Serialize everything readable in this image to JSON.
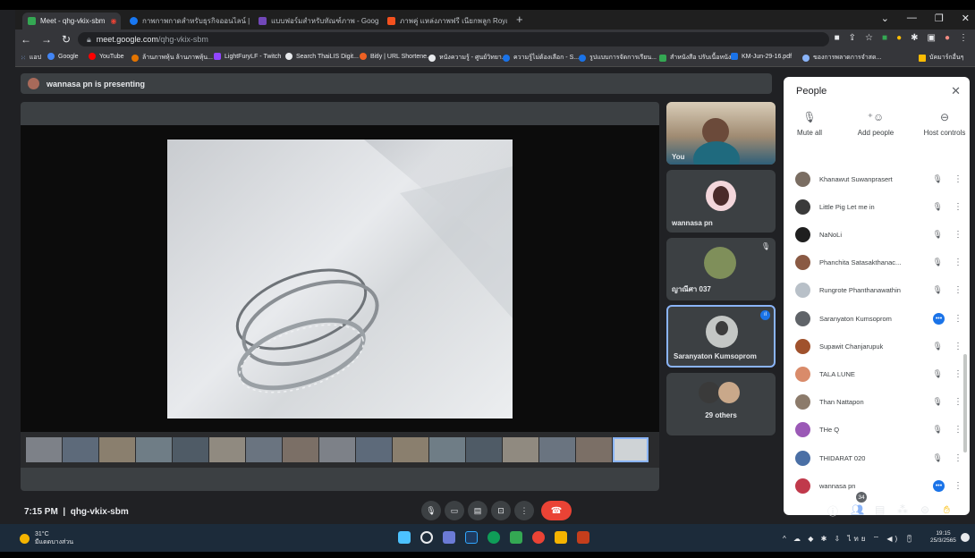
{
  "browser": {
    "tabs": [
      {
        "label": "Meet - qhg-vkix-sbm",
        "color": "#34a853"
      },
      {
        "label": "กาพกาพกาดสำหรับธุรกิจออนไลน์ | Fac",
        "color": "#1877f2"
      },
      {
        "label": "แบบฟอร์มสำหรับทัณฑ์ภาพ - Google ร",
        "color": "#7248b9"
      },
      {
        "label": "ภาพคู่ แหล่งภาพฟรี เนียกพลูก Royal",
        "color": "#f4511e"
      }
    ],
    "url_host": "meet.google.com",
    "url_path": "/qhg-vkix-sbm",
    "bookmarks": [
      "แอป",
      "Google",
      "YouTube",
      "ล้านภาพหุ้น ล้านภาพหุ้น...",
      "LightFuryLF - Twitch",
      "Search ThaiLIS Digit...",
      "Bitly | URL Shortene...",
      "หนังความรู้ - ศูนย์วิทยา...",
      "ความรู้ไม่ต้องเลือก - S...",
      "รูปแบบการจัดการเรียน...",
      "สำหนังสือ ปรับเนื้อหนัง...",
      "KM-Jun-29-16.pdf",
      "ของการพลาดการจำสด...",
      "บัคมาร์กอื่นๆ"
    ]
  },
  "meet": {
    "presenting_text": "wannasa pn is presenting",
    "meeting_time": "7:15 PM",
    "meeting_code": "qhg-vkix-sbm",
    "tiles": [
      {
        "name": "You"
      },
      {
        "name": "wannasa pn"
      },
      {
        "name": "ญาณีศา 037"
      },
      {
        "name": "Saranyaton Kumsoprom"
      },
      {
        "name": "29 others"
      }
    ],
    "participant_count": "34"
  },
  "people_panel": {
    "title": "People",
    "actions": [
      "Mute all",
      "Add people",
      "Host controls"
    ],
    "participants": [
      {
        "name": "Khanawut Suwanprasert",
        "speaking": false,
        "color": "#7a6d62"
      },
      {
        "name": "Little Pig Let me in",
        "speaking": false,
        "color": "#3a3a3a"
      },
      {
        "name": "NaNoLi",
        "speaking": false,
        "color": "#1f1f1f"
      },
      {
        "name": "Phanchita Satasakthanac...",
        "speaking": false,
        "color": "#8a5a44"
      },
      {
        "name": "Rungrote Phanthanawathin",
        "speaking": false,
        "color": "#b8c0c8"
      },
      {
        "name": "Saranyaton Kumsoprom",
        "speaking": true,
        "color": "#5f6368"
      },
      {
        "name": "Supawit Chanjarupuk",
        "speaking": false,
        "color": "#a0522d"
      },
      {
        "name": "TALA LUNE",
        "speaking": false,
        "color": "#d98b6a"
      },
      {
        "name": "Than Nattapon",
        "speaking": false,
        "color": "#8c7b6b"
      },
      {
        "name": "THe Q",
        "speaking": false,
        "color": "#9b59b6"
      },
      {
        "name": "THIDARAT 020",
        "speaking": false,
        "color": "#4a6fa5"
      },
      {
        "name": "wannasa pn",
        "speaking": true,
        "color": "#c0394b"
      }
    ]
  },
  "taskbar": {
    "temperature": "31°C",
    "weather_label": "มีแดดบางส่วน",
    "clock_time": "19:15",
    "clock_date": "25/3/2565"
  }
}
